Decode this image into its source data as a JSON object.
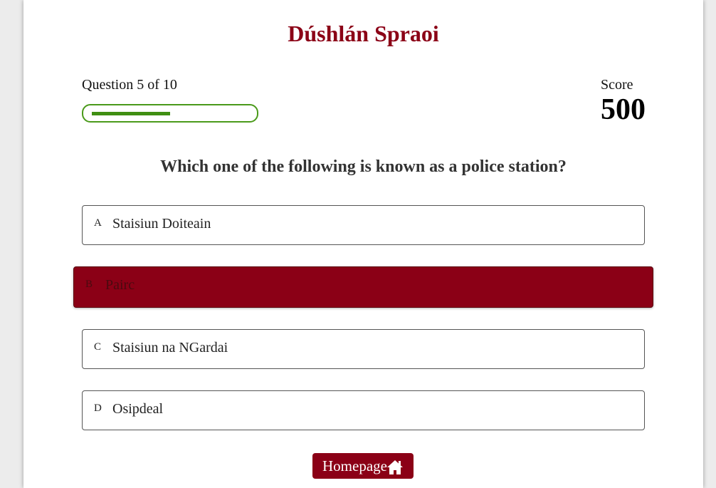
{
  "header": {
    "title": "Dúshlán Spraoi"
  },
  "progress": {
    "text": "Question 5 of 10",
    "fraction": 0.5
  },
  "score": {
    "label": "Score",
    "value": "500"
  },
  "question": {
    "text": "Which one of the following is known as a police station?"
  },
  "options": [
    {
      "letter": "A",
      "text": "Staisiun Doiteain"
    },
    {
      "letter": "B",
      "text": "Pairc"
    },
    {
      "letter": "C",
      "text": "Staisiun na NGardai"
    },
    {
      "letter": "D",
      "text": "Osipdeal"
    }
  ],
  "selected_option": "B",
  "footer": {
    "home_label": "Homepage",
    "home_icon": "home-icon"
  },
  "colors": {
    "brand": "#8b0016",
    "progress": "#3f8f12"
  }
}
